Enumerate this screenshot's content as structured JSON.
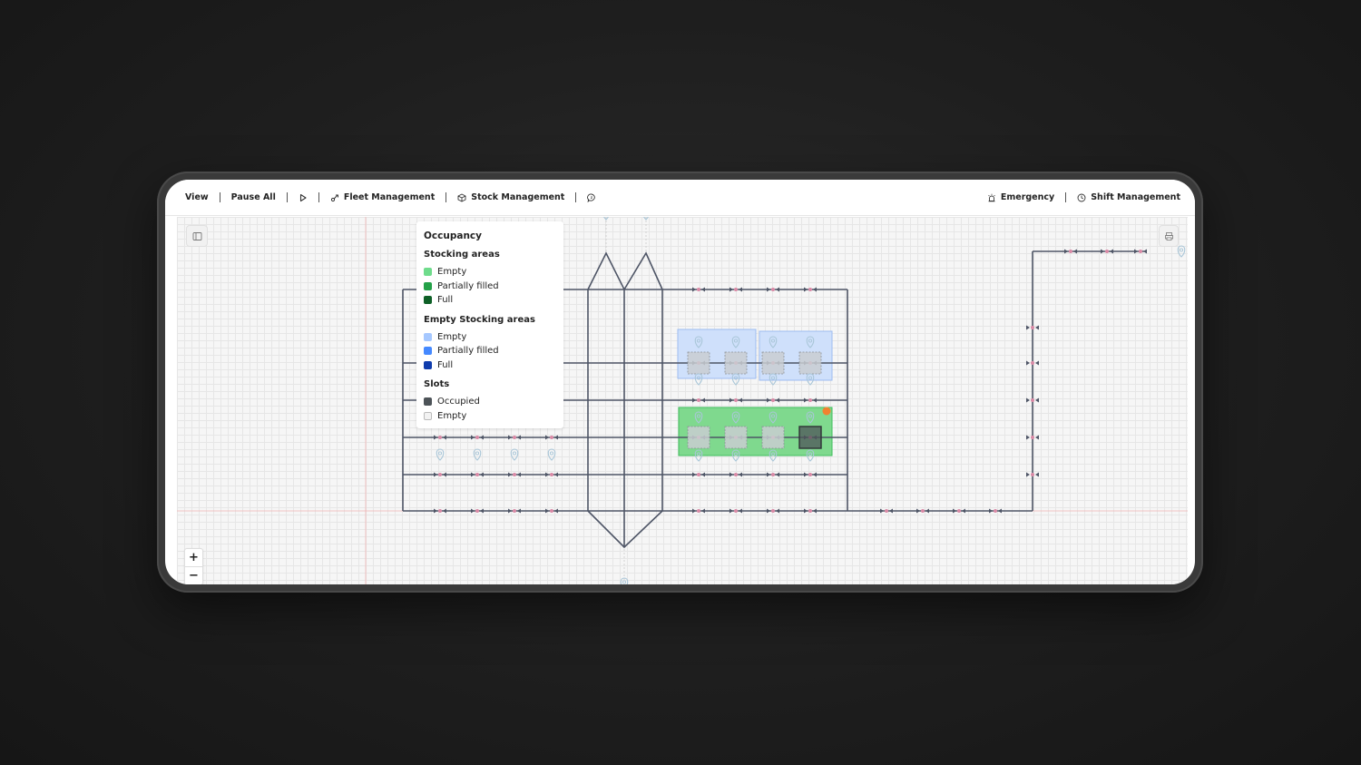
{
  "toolbar": {
    "view": "View",
    "pause_all": "Pause All",
    "fleet_management": "Fleet Management",
    "stock_management": "Stock Management",
    "emergency": "Emergency",
    "shift_management": "Shift Management"
  },
  "legend": {
    "title": "Occupancy",
    "stocking_areas": {
      "heading": "Stocking areas",
      "items": [
        {
          "label": "Empty",
          "color": "#6fdc8c"
        },
        {
          "label": "Partially filled",
          "color": "#24a148"
        },
        {
          "label": "Full",
          "color": "#0e6027"
        }
      ]
    },
    "empty_stocking_areas": {
      "heading": "Empty Stocking areas",
      "items": [
        {
          "label": "Empty",
          "color": "#a6c8ff"
        },
        {
          "label": "Partially filled",
          "color": "#4589ff"
        },
        {
          "label": "Full",
          "color": "#0f3cad"
        }
      ]
    },
    "slots": {
      "heading": "Slots",
      "items": [
        {
          "label": "Occupied",
          "color": "#4d5358"
        },
        {
          "label": "Empty",
          "color": "#f2f2f2"
        }
      ]
    }
  },
  "zoom": {
    "in": "+",
    "out": "−"
  },
  "colors": {
    "path": "#4e5566",
    "node": "#d98aa6",
    "marker": "#a9c6d8",
    "empty_area_fill": "#cfe0fb",
    "stock_area_fill": "#7fd98e",
    "alert": "#f0822f",
    "guide_line": "#f0b3b3"
  }
}
